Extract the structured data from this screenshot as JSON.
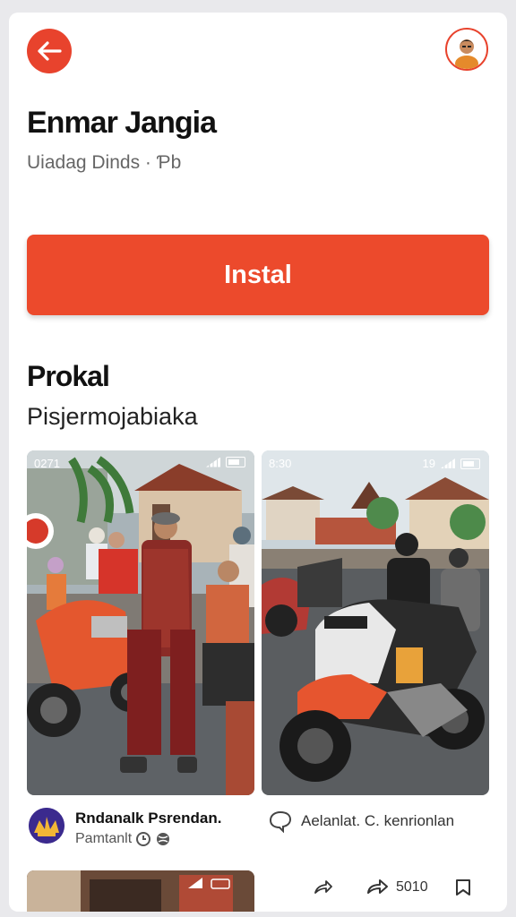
{
  "header": {
    "back_icon": "arrow-left-icon",
    "avatar_icon": "profile-avatar"
  },
  "app": {
    "title": "Enmar Jangia",
    "subtitle": "Uiadag Dinds · Ƥb",
    "install_label": "Instal"
  },
  "section": {
    "title": "Prokal",
    "subtitle": "Pisjermojabiaka"
  },
  "screenshots": [
    {
      "time": "0271",
      "status_right": ""
    },
    {
      "time": "8:30",
      "status_right": "19"
    }
  ],
  "post": {
    "author": "Rndanalk Psrendan.",
    "meta": "Pamtanlt",
    "comment_text": "Aelanlat. C. kenrionlan"
  },
  "actions": {
    "share_count": "5010",
    "icons": [
      "share-arrow-icon",
      "repost-icon",
      "bookmark-icon"
    ]
  },
  "colors": {
    "accent": "#ec4a2c",
    "back_button": "#e8432d"
  }
}
